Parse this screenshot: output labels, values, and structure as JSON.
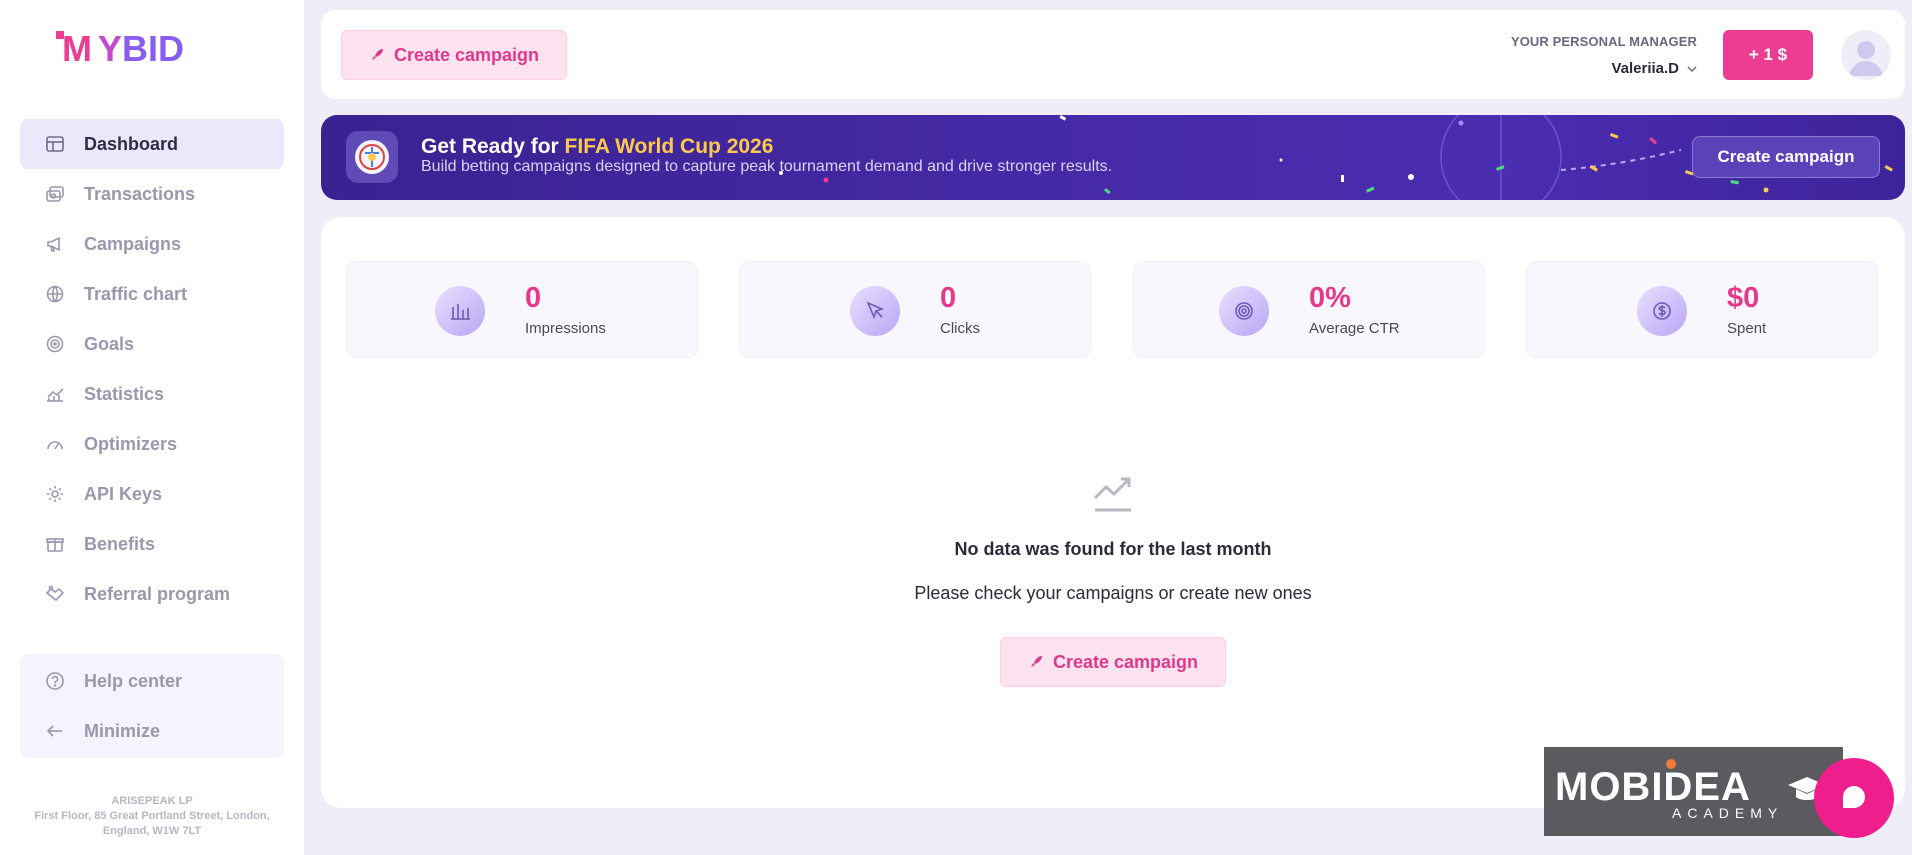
{
  "app": {
    "logo_text": "MYBID"
  },
  "sidebar": {
    "items": [
      {
        "label": "Dashboard",
        "icon": "dashboard-icon",
        "active": true
      },
      {
        "label": "Transactions",
        "icon": "transactions-icon"
      },
      {
        "label": "Campaigns",
        "icon": "megaphone-icon"
      },
      {
        "label": "Traffic chart",
        "icon": "globe-icon"
      },
      {
        "label": "Goals",
        "icon": "target-icon"
      },
      {
        "label": "Statistics",
        "icon": "chart-icon"
      },
      {
        "label": "Optimizers",
        "icon": "gauge-icon"
      },
      {
        "label": "API Keys",
        "icon": "gear-icon"
      },
      {
        "label": "Benefits",
        "icon": "gift-icon"
      },
      {
        "label": "Referral program",
        "icon": "handshake-icon"
      }
    ],
    "bottom": [
      {
        "label": "Help center",
        "icon": "help-icon"
      },
      {
        "label": "Minimize",
        "icon": "arrow-left-icon"
      }
    ],
    "address": {
      "line1": "ARISEPEAK LP",
      "line2": "First Floor, 85 Great Portland Street, London,",
      "line3": "England, W1W 7LT"
    }
  },
  "topbar": {
    "create_label": "Create campaign",
    "manager_label": "YOUR PERSONAL MANAGER",
    "manager_name": "Valeriia.D",
    "topup_label": "+ 1 $"
  },
  "banner": {
    "title_prefix": "Get Ready for ",
    "title_highlight": "FIFA World Cup 2026",
    "subtitle": "Build betting campaigns designed to capture peak tournament demand and drive stronger results.",
    "button_label": "Create campaign"
  },
  "stats": [
    {
      "value": "0",
      "label": "Impressions",
      "icon": "bar-chart-icon"
    },
    {
      "value": "0",
      "label": "Clicks",
      "icon": "cursor-icon"
    },
    {
      "value": "0%",
      "label": "Average CTR",
      "icon": "target-icon"
    },
    {
      "value": "$0",
      "label": "Spent",
      "icon": "dollar-icon"
    }
  ],
  "empty": {
    "title": "No data was found for the last month",
    "subtitle": "Please check your campaigns or create new ones",
    "button_label": "Create campaign"
  },
  "mobidea": {
    "word": "MOBIDEA",
    "sub": "ACADEMY"
  },
  "colors": {
    "accent": "#ec3d93",
    "brand_purple": "#7b5cf0",
    "banner": "#452aa6",
    "highlight": "#ffc94d"
  }
}
